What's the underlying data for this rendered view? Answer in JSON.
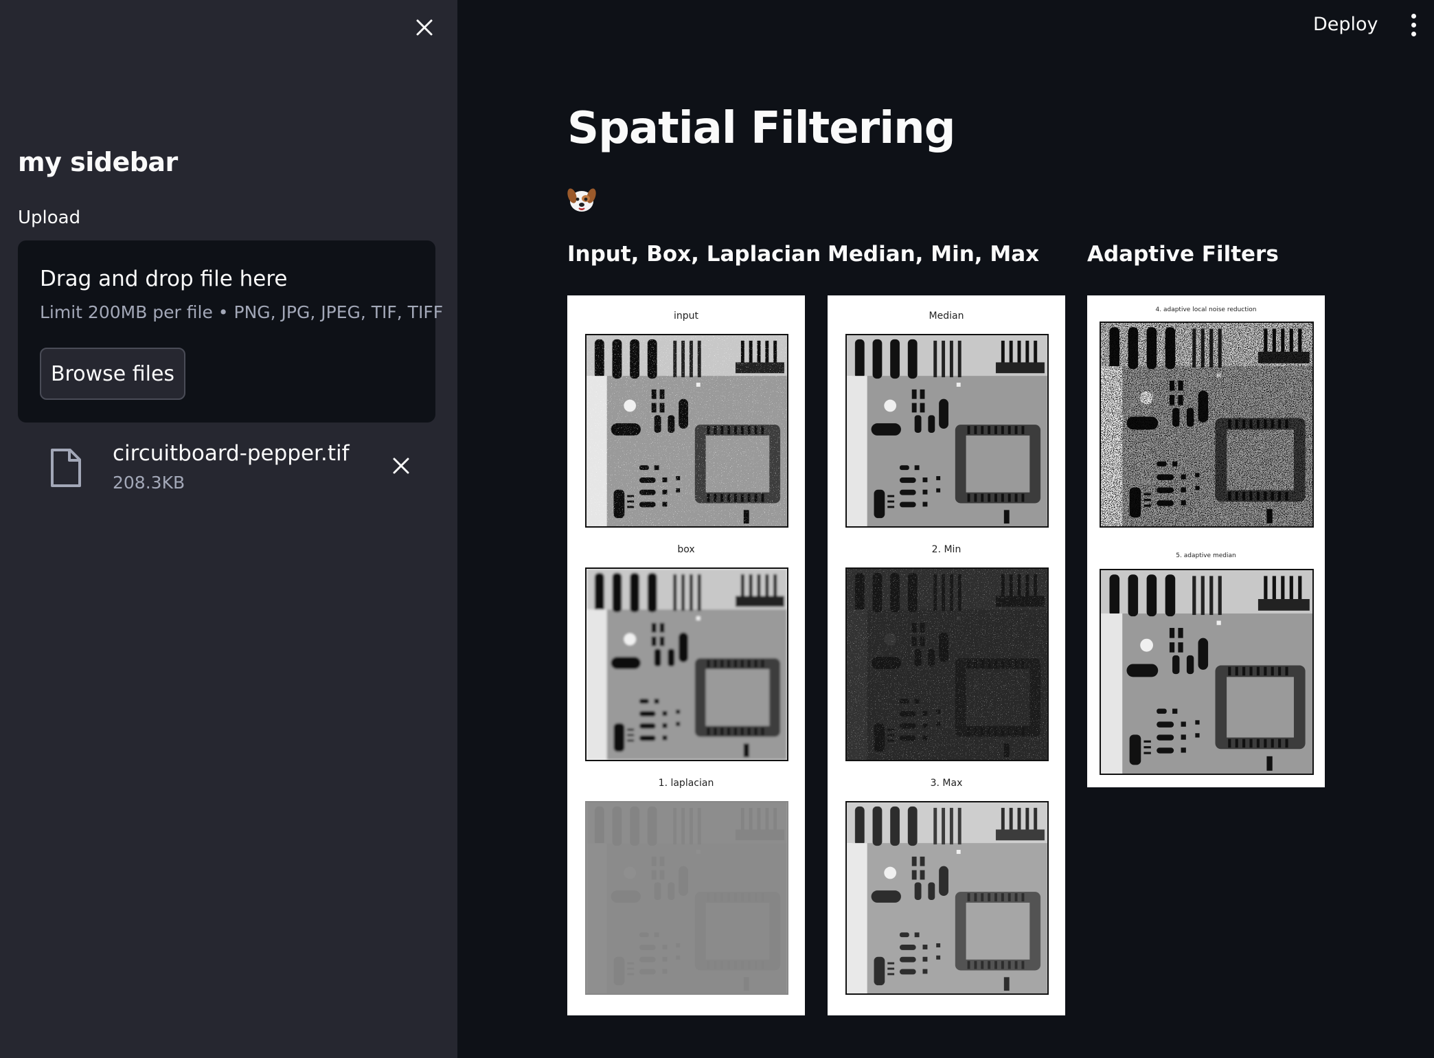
{
  "sidebar": {
    "close_icon": "close-icon",
    "title": "my sidebar",
    "upload": {
      "label": "Upload",
      "dropzone_title": "Drag and drop file here",
      "dropzone_limit": "Limit 200MB per file • PNG, JPG, JPEG, TIF, TIFF",
      "browse_label": "Browse files"
    },
    "file": {
      "icon": "file-icon",
      "name": "circuitboard-pepper.tif",
      "size": "208.3KB",
      "remove_icon": "close-icon"
    }
  },
  "header": {
    "deploy_label": "Deploy",
    "menu_icon": "more-vertical-icon"
  },
  "main": {
    "title": "Spatial Filtering",
    "emoji": "dog-face-icon",
    "columns": [
      {
        "header": "Input, Box, Laplacian",
        "panels": [
          {
            "title": "input",
            "style": "noisy"
          },
          {
            "title": "box",
            "style": "blurred"
          },
          {
            "title": "1. laplacian",
            "style": "flat-gray"
          }
        ]
      },
      {
        "header": "Median, Min, Max",
        "panels": [
          {
            "title": "Median",
            "style": "clean"
          },
          {
            "title": "2. Min",
            "style": "dark-noisy"
          },
          {
            "title": "3. Max",
            "style": "clean-bright"
          }
        ]
      },
      {
        "header": "Adaptive Filters",
        "panels": [
          {
            "title": "4. adaptive local noise reduction",
            "style": "high-contrast-noisy"
          },
          {
            "title": "5. adaptive median",
            "style": "clean-contrast"
          }
        ]
      }
    ]
  },
  "colors": {
    "main_bg": "#0e1117",
    "sidebar_bg": "#262730",
    "text": "#fafafa",
    "muted_text": "#a3a8b8"
  }
}
